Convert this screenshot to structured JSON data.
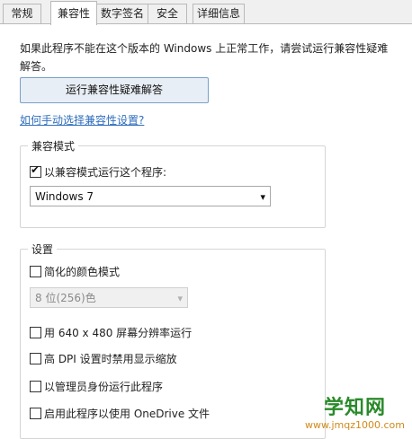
{
  "tabs": [
    "常规",
    "兼容性",
    "数字签名",
    "安全",
    "详细信息"
  ],
  "intro_text": "如果此程序不能在这个版本的 Windows 上正常工作，请尝试运行兼容性疑难解答。",
  "troubleshoot_button": "运行兼容性疑难解答",
  "manual_link": "如何手动选择兼容性设置?",
  "compat_mode": {
    "legend": "兼容模式",
    "checkbox_label": "以兼容模式运行这个程序:",
    "checked": true,
    "selected_os": "Windows 7"
  },
  "settings": {
    "legend": "设置",
    "reduced_color_label": "简化的颜色模式",
    "color_option": "8 位(256)色",
    "res_label": "用 640 x 480 屏幕分辨率运行",
    "dpi_label": "高 DPI 设置时禁用显示缩放",
    "admin_label": "以管理员身份运行此程序",
    "onedrive_label": "启用此程序以使用 OneDrive 文件"
  },
  "watermark": {
    "title": "学知网",
    "url": "www.jmqz1000.com"
  },
  "colors": {
    "link": "#2f6ebd",
    "watermark_green": "#2a8a2a",
    "watermark_orange": "#d08a1a"
  }
}
